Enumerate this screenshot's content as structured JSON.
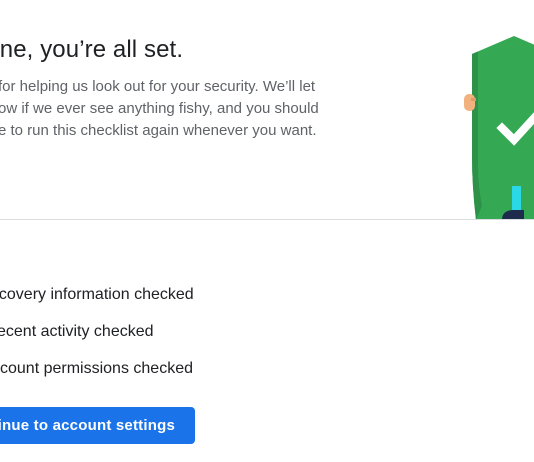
{
  "header": {
    "title": "y done, you’re all set.",
    "message_lines": [
      "for helping us look out for your security. We’ll let",
      "ow if we ever see anything fishy, and you should",
      "e to run this checklist again whenever you want."
    ]
  },
  "illustration": {
    "icon": "security-shield-check-icon",
    "shield_color": "#34a853",
    "check_color": "#ffffff",
    "figure_pants_color": "#2bd9e6",
    "figure_shoe_color": "#1f2b4d"
  },
  "checklist": {
    "items": [
      {
        "label": "ecovery information checked"
      },
      {
        "label": "ecent activity checked"
      },
      {
        "label": "ccount permissions checked"
      }
    ]
  },
  "actions": {
    "continue_label": "inue to account settings",
    "accent": "#1a73e8"
  }
}
